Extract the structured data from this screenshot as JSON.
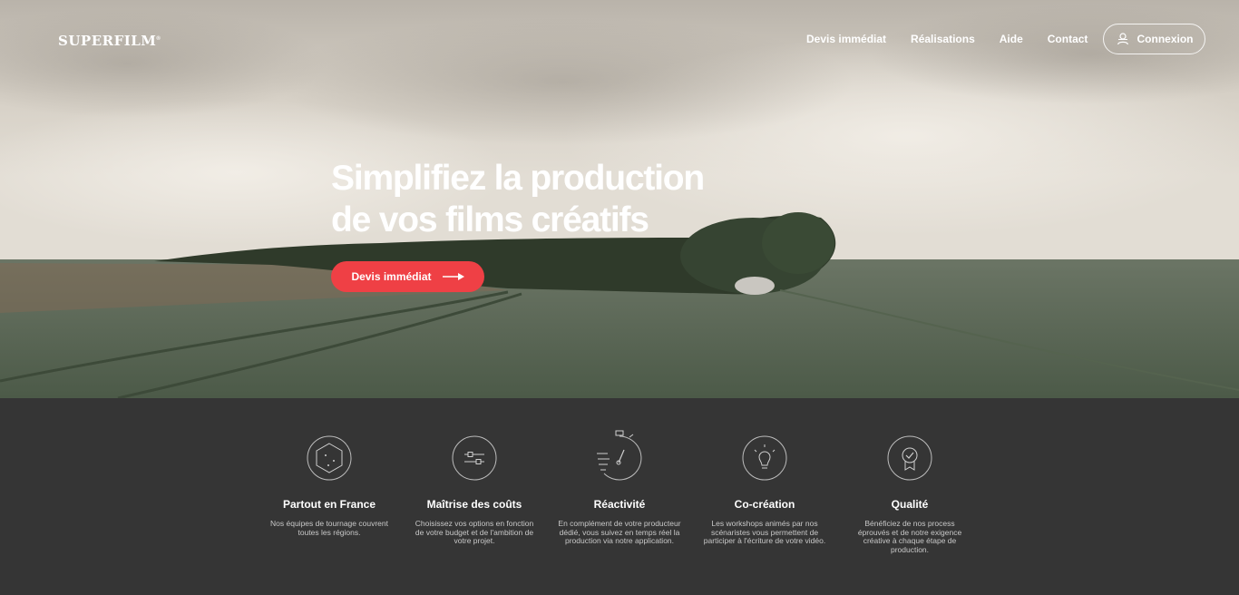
{
  "brand": {
    "name": "SUPERFILM",
    "mark": "®"
  },
  "nav": {
    "links": [
      "Devis immédiat",
      "Réalisations",
      "Aide",
      "Contact"
    ],
    "login_label": "Connexion"
  },
  "hero": {
    "title_line1": "Simplifiez la production",
    "title_line2": "de vos films créatifs",
    "cta_label": "Devis immédiat"
  },
  "features": [
    {
      "icon": "hexagon-map-icon",
      "title": "Partout en France",
      "desc": "Nos équipes de tournage couvrent toutes les régions."
    },
    {
      "icon": "sliders-icon",
      "title": "Maîtrise des coûts",
      "desc": "Choisissez vos options en fonction de votre budget et de l'ambition de votre projet."
    },
    {
      "icon": "stopwatch-icon",
      "title": "Réactivité",
      "desc": "En complément de votre producteur dédié, vous suivez en temps réel la production via notre application."
    },
    {
      "icon": "lightbulb-icon",
      "title": "Co-création",
      "desc": "Les workshops animés par nos scénaristes vous permettent de participer à l'écriture de votre vidéo."
    },
    {
      "icon": "quality-badge-icon",
      "title": "Qualité",
      "desc": "Bénéficiez de nos process éprouvés et de notre exigence créative à chaque étape de production."
    }
  ],
  "colors": {
    "accent": "#ef4045",
    "dark_bg": "#353535",
    "text_light": "#ffffff",
    "text_muted": "#c8c8c8"
  }
}
